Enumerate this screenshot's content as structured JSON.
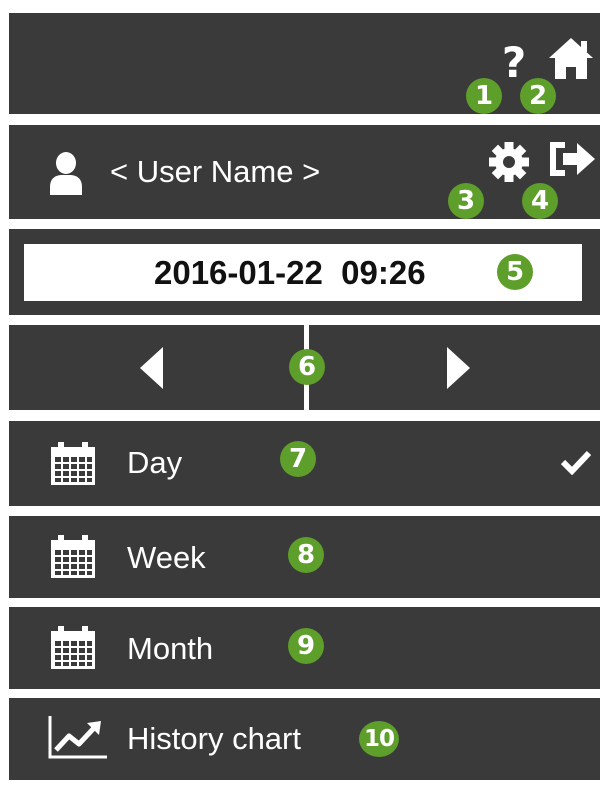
{
  "header": {
    "help_badge": "1",
    "home_badge": "2"
  },
  "user_bar": {
    "user_name": "< User Name >",
    "settings_badge": "3",
    "logout_badge": "4"
  },
  "date_bar": {
    "datetime": "2016-01-22  09:26",
    "badge": "5"
  },
  "nav_bar": {
    "badge": "6"
  },
  "menu": {
    "items": [
      {
        "label": "Day",
        "badge": "7",
        "selected": true,
        "icon": "calendar-icon"
      },
      {
        "label": "Week",
        "badge": "8",
        "selected": false,
        "icon": "calendar-icon"
      },
      {
        "label": "Month",
        "badge": "9",
        "selected": false,
        "icon": "calendar-icon"
      },
      {
        "label": "History chart",
        "badge": "10",
        "selected": false,
        "icon": "line-chart-icon"
      }
    ]
  },
  "colors": {
    "panel": "#3a3a3a",
    "badge": "#5e9e2b",
    "text": "#ffffff"
  }
}
